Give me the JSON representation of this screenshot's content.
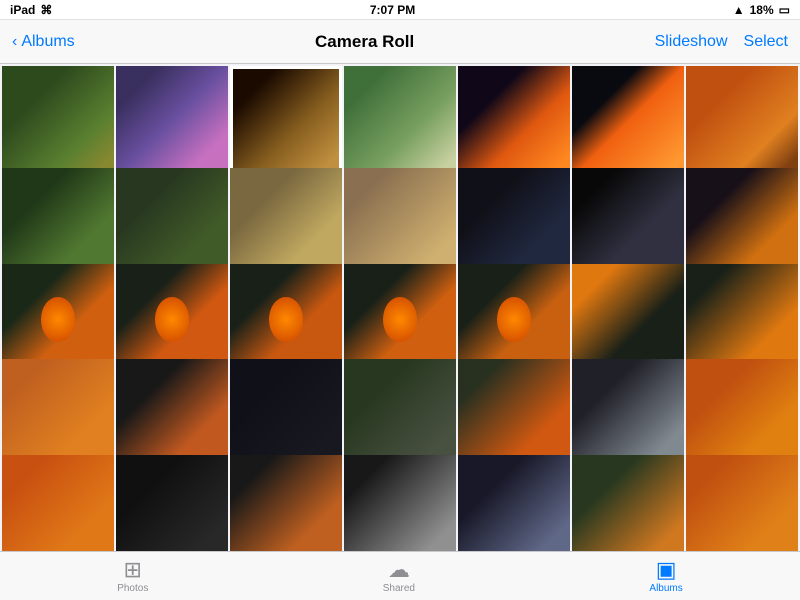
{
  "statusBar": {
    "left": "iPad",
    "wifi": "wifi",
    "time": "7:07 PM",
    "signal": "▲",
    "battery": "18%"
  },
  "navBar": {
    "backLabel": "Albums",
    "title": "Camera Roll",
    "slideshowLabel": "Slideshow",
    "selectLabel": "Select"
  },
  "tabBar": {
    "tabs": [
      {
        "id": "photos",
        "label": "Photos",
        "icon": "▦",
        "active": false
      },
      {
        "id": "shared",
        "label": "Shared",
        "icon": "☁",
        "active": false
      },
      {
        "id": "albums",
        "label": "Albums",
        "icon": "▣",
        "active": true
      }
    ]
  },
  "grid": {
    "rows": 5,
    "cols": 7,
    "totalPhotos": 35
  }
}
